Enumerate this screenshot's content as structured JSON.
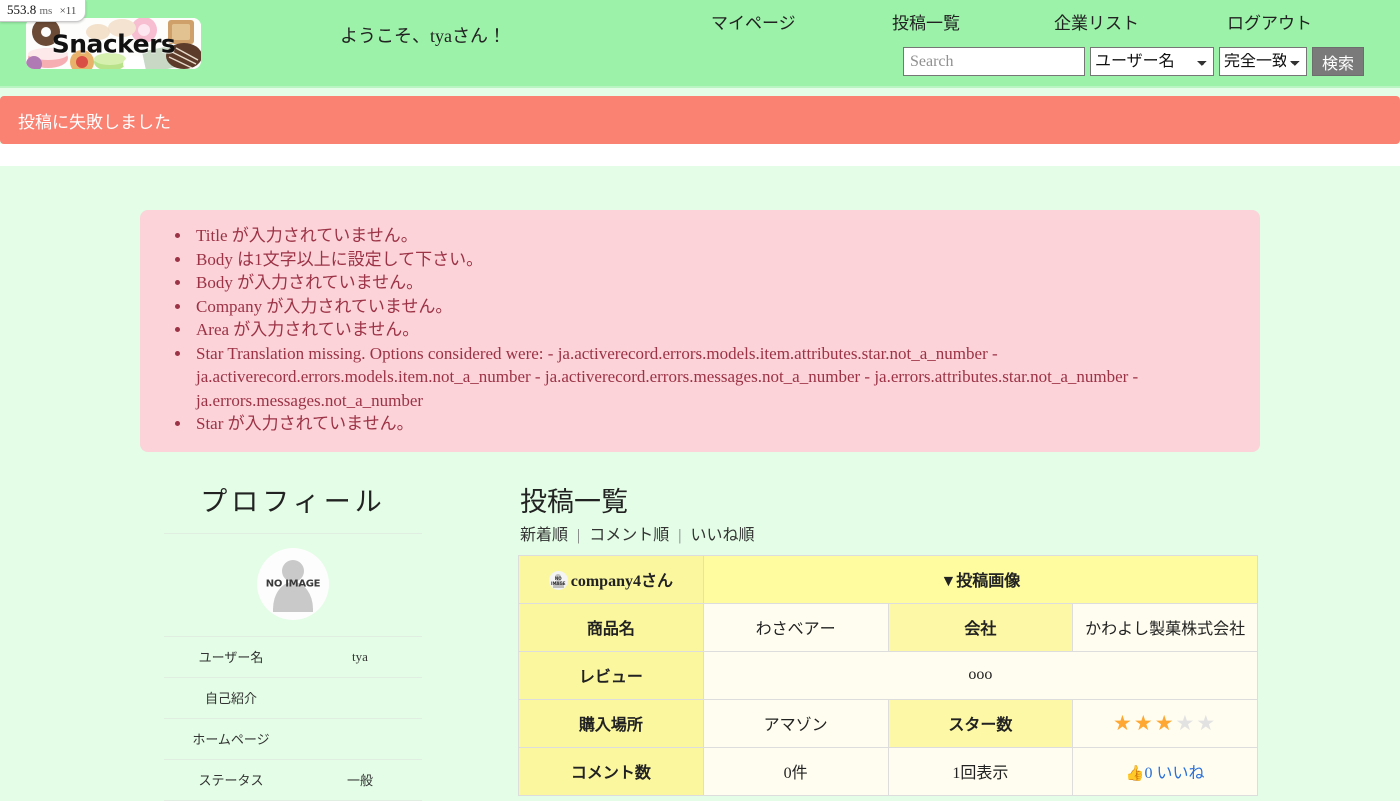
{
  "profiler": {
    "time": "553.8",
    "unit": "ms",
    "count": "×11"
  },
  "header": {
    "logo_text": "Snackers",
    "welcome": "ようこそ、tyaさん！",
    "nav": [
      {
        "label": "マイページ"
      },
      {
        "label": "投稿一覧"
      },
      {
        "label": "企業リスト"
      },
      {
        "label": "ログアウト"
      }
    ],
    "search": {
      "value": "",
      "placeholder": "Search",
      "kind_selected": "ユーザー名",
      "match_selected": "完全一致",
      "button_label": "検索"
    }
  },
  "alert": {
    "message": "投稿に失敗しました",
    "color": "#f98273"
  },
  "errors": {
    "items": [
      "Title が入力されていません。",
      "Body は1文字以上に設定して下さい。",
      "Body が入力されていません。",
      "Company が入力されていません。",
      "Area が入力されていません。",
      "Star Translation missing. Options considered were: - ja.activerecord.errors.models.item.attributes.star.not_a_number - ja.activerecord.errors.models.item.not_a_number - ja.activerecord.errors.messages.not_a_number - ja.errors.attributes.star.not_a_number - ja.errors.messages.not_a_number",
      "Star が入力されていません。"
    ]
  },
  "profile": {
    "title": "プロフィール",
    "avatar_label": "NO IMAGE",
    "rows": [
      {
        "key": "ユーザー名",
        "value": "tya"
      },
      {
        "key": "自己紹介",
        "value": ""
      },
      {
        "key": "ホームページ",
        "value": ""
      },
      {
        "key": "ステータス",
        "value": "一般"
      }
    ]
  },
  "posts": {
    "title": "投稿一覧",
    "sorts": [
      {
        "label": "新着順"
      },
      {
        "label": "コメント順"
      },
      {
        "label": "いいね順"
      }
    ],
    "table": {
      "user": "company4さん",
      "avatar_label": "NO IMAGE",
      "image_header": "▼投稿画像",
      "product_label": "商品名",
      "product_value": "わさべアー",
      "company_label": "会社",
      "company_value": "かわよし製菓株式会社",
      "review_label": "レビュー",
      "review_value": "ooo",
      "place_label": "購入場所",
      "place_value": "アマゾン",
      "star_label": "スター数",
      "star_filled": 3,
      "star_total": 5,
      "comment_label": "コメント数",
      "comment_value": "0件",
      "views_value": "1回表示",
      "like_count": "0",
      "like_label": "いいね"
    }
  },
  "colors": {
    "header_bg": "#9bf2a8",
    "body_bg": "#e3fde6",
    "alert_bg": "#f98273",
    "error_bg": "#fbd3d9",
    "error_text": "#9c3245",
    "table_label_bg": "#fbf79f",
    "star_on": "#ffa733",
    "star_off": "#e2e2e2",
    "like_blue": "#2a6fdb"
  }
}
